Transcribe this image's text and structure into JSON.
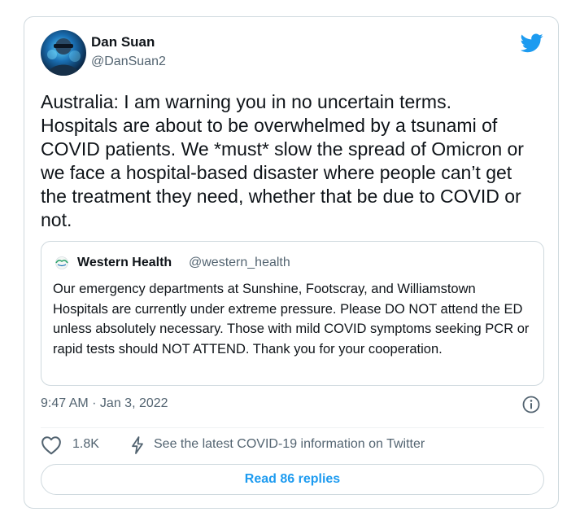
{
  "tweet": {
    "author": {
      "name": "Dan Suan",
      "handle": "@DanSuan2",
      "avatar": "avatar-photo"
    },
    "platform_icon": "twitter-bird-icon",
    "text": "Australia: I am warning you in no uncertain terms.\nHospitals are about to be overwhelmed by a tsunami of\nCOVID patients. We *must* slow the spread of Omicron or\nwe face a hospital-based disaster where people can’t get\nthe treatment they need, whether that be due to COVID or\nnot.",
    "quote": {
      "name": "Western Health",
      "handle": "@western_health",
      "logo": "western-health-logo",
      "text": "Our emergency departments at Sunshine, Footscray, and Williamstown Hospitals are currently under extreme pressure. Please DO NOT attend the ED unless absolutely necessary. Those with mild COVID symptoms seeking PCR or rapid tests should NOT ATTEND. Thank you for your cooperation."
    },
    "timestamp": "9:47 AM · Jan 3, 2022",
    "info_icon": "info-icon",
    "likes": "1.8K",
    "like_icon": "heart-icon",
    "covid_icon": "lightning-bolt-icon",
    "covid_link": "See the latest COVID-19 information on Twitter",
    "read_replies": "Read 86 replies"
  },
  "colors": {
    "accent": "#1d9bf0",
    "text_primary": "#0f1419",
    "text_secondary": "#536471",
    "border": "#cfd9de"
  }
}
